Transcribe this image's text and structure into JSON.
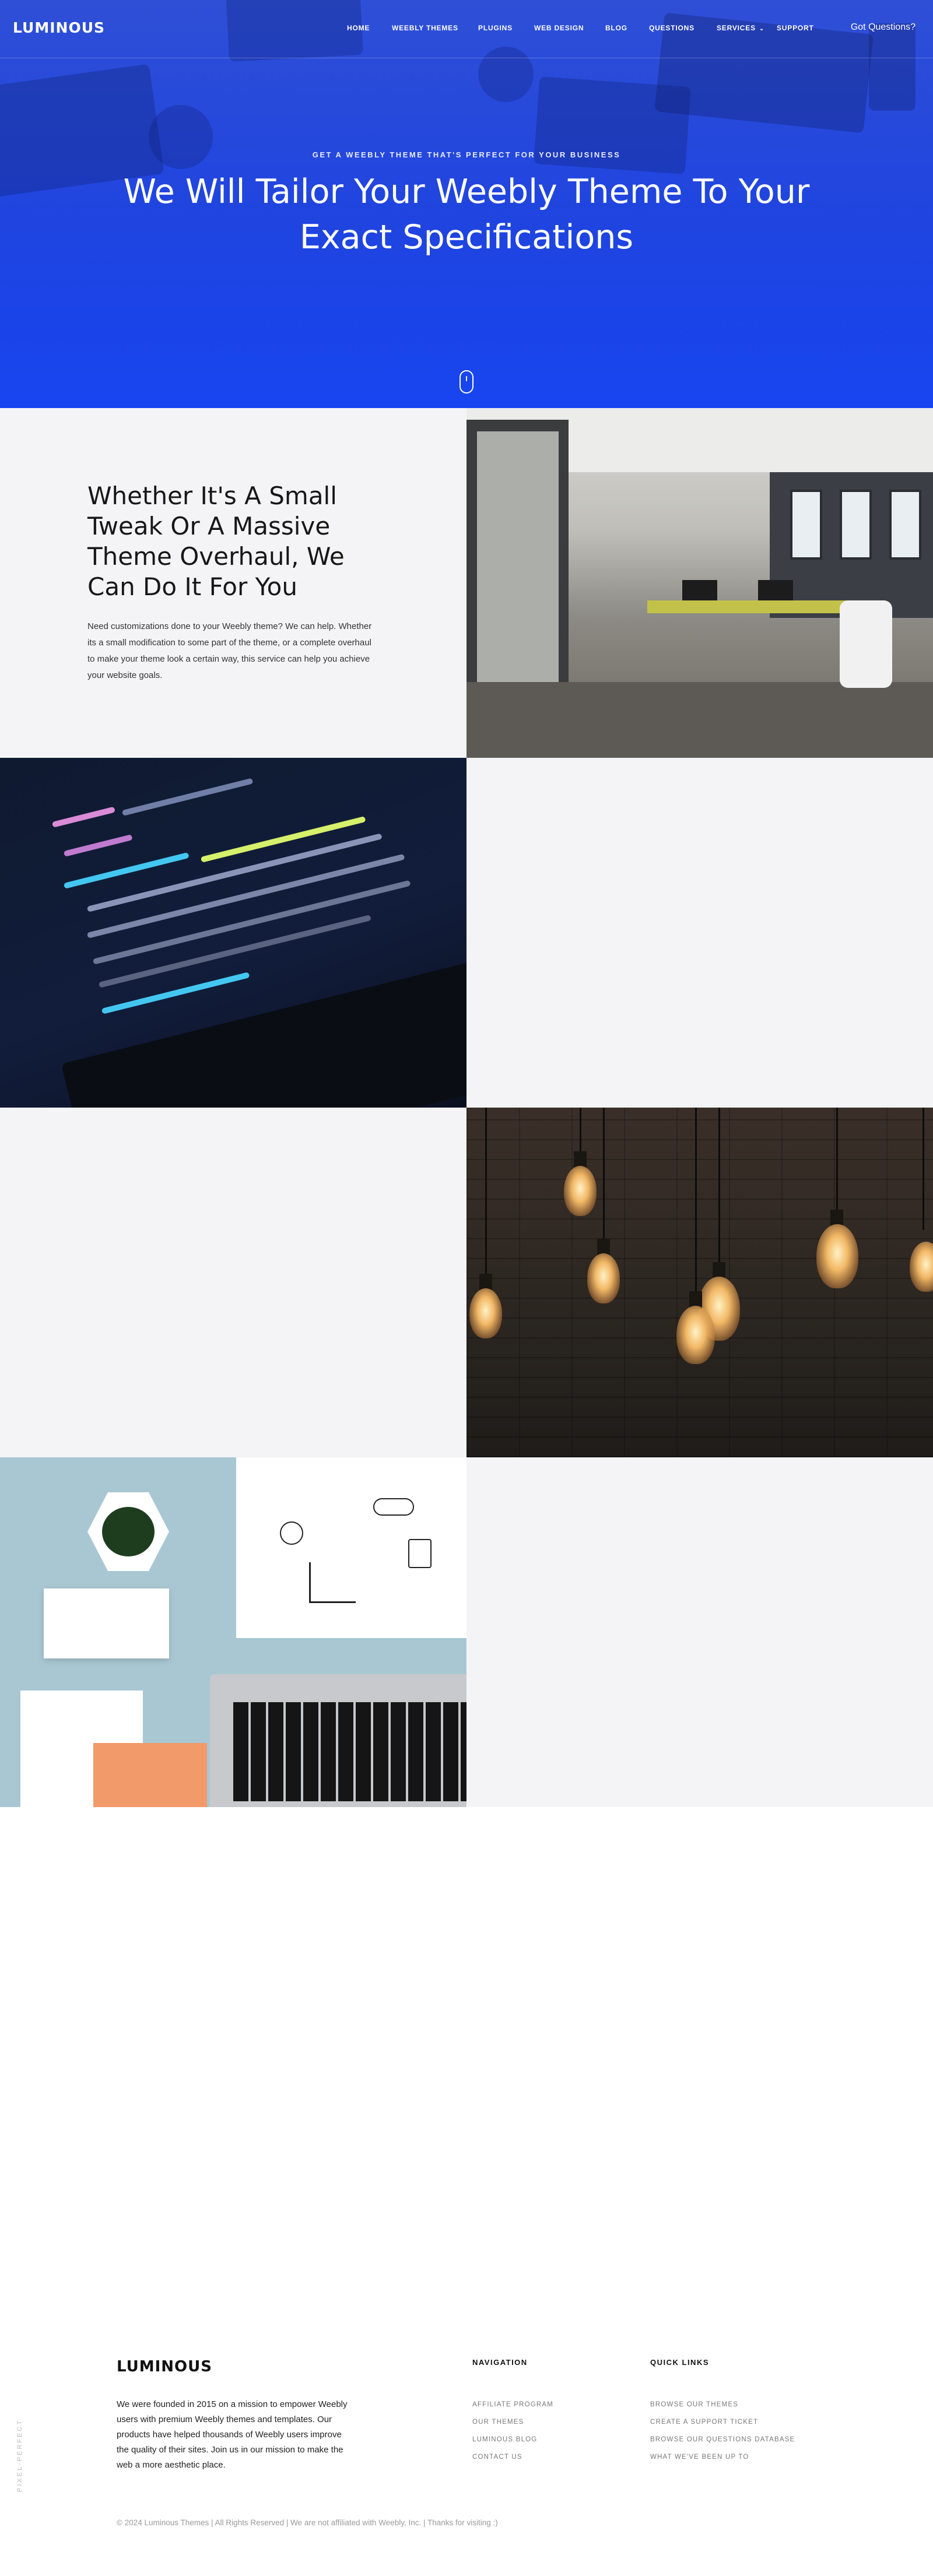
{
  "header": {
    "logo": "LUMINOUS",
    "menu": [
      {
        "label": "HOME"
      },
      {
        "label": "WEEBLY THEMES"
      },
      {
        "label": "PLUGINS"
      },
      {
        "label": "WEB DESIGN"
      },
      {
        "label": "BLOG"
      },
      {
        "label": "QUESTIONS"
      },
      {
        "label": "SERVICES",
        "has_dropdown": true
      },
      {
        "label": "SUPPORT"
      }
    ],
    "cta": "Got Questions?"
  },
  "hero": {
    "kicker": "GET A WEEBLY THEME THAT'S PERFECT FOR YOUR BUSINESS",
    "title": "We Will Tailor Your Weebly Theme To Your Exact Specifications",
    "accent_color": "#1f45e6"
  },
  "intro": {
    "heading": "Whether It's A Small Tweak Or A Massive Theme Overhaul, We Can Do It For You",
    "body": "Need customizations done to your Weebly theme? We can help. Whether its a small modification to some part of the theme, or a complete overhaul to make your theme look a certain way, this service can help you achieve your website goals."
  },
  "images": [
    {
      "name": "office-photo"
    },
    {
      "name": "code-screen-photo"
    },
    {
      "name": "light-bulbs-photo"
    },
    {
      "name": "desk-flatlay-photo"
    }
  ],
  "footer": {
    "vertical_tag": "PIXEL-PERFECT",
    "logo": "LUMINOUS",
    "about": "We were founded in 2015 on a mission to empower Weebly users with premium Weebly themes and templates. Our products have helped thousands of Weebly users improve the quality of their sites. Join us in our mission to make the web a more aesthetic place.",
    "navigation": {
      "heading": "NAVIGATION",
      "links": [
        "AFFILIATE PROGRAM",
        "OUR THEMES",
        "LUMINOUS BLOG",
        "CONTACT US"
      ]
    },
    "quick_links": {
      "heading": "QUICK LINKS",
      "links": [
        "BROWSE OUR THEMES",
        "CREATE A SUPPORT TICKET",
        "BROWSE OUR QUESTIONS DATABASE",
        "WHAT WE'VE BEEN UP TO"
      ]
    },
    "copyright": "© 2024 Luminous Themes | All Rights Reserved | We are not affiliated with Weebly, Inc. | Thanks for visiting :)"
  }
}
